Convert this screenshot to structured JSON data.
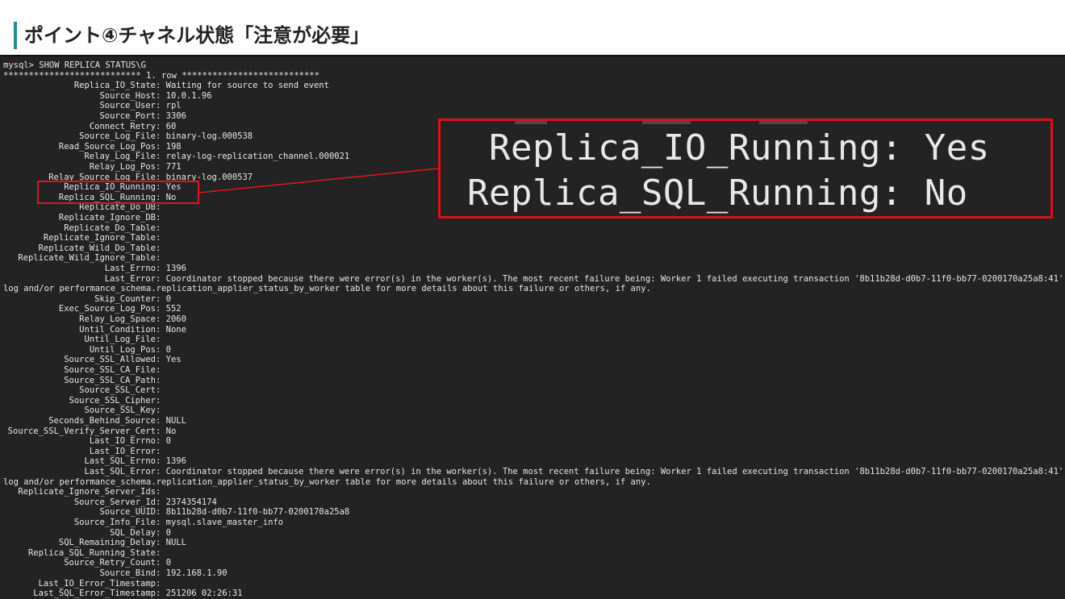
{
  "slide": {
    "title": "ポイント④チャネル状態「注意が必要」",
    "accent_color": "#1f8f94",
    "highlight_color": "#e0161e"
  },
  "terminal": {
    "command": "mysql> SHOW REPLICA STATUS\\G",
    "row_header": "*************************** 1. row ***************************",
    "rows": [
      {
        "k": "Replica_IO_State",
        "v": "Waiting for source to send event"
      },
      {
        "k": "Source_Host",
        "v": "10.0.1.96"
      },
      {
        "k": "Source_User",
        "v": "rpl"
      },
      {
        "k": "Source_Port",
        "v": "3306"
      },
      {
        "k": "Connect_Retry",
        "v": "60"
      },
      {
        "k": "Source_Log_File",
        "v": "binary-log.000538"
      },
      {
        "k": "Read_Source_Log_Pos",
        "v": "198"
      },
      {
        "k": "Relay_Log_File",
        "v": "relay-log-replication_channel.000021"
      },
      {
        "k": "Relay_Log_Pos",
        "v": "771"
      },
      {
        "k": "Relay_Source_Log_File",
        "v": "binary-log.000537"
      },
      {
        "k": "Replica_IO_Running",
        "v": "Yes"
      },
      {
        "k": "Replica_SQL_Running",
        "v": "No"
      },
      {
        "k": "Replicate_Do_DB",
        "v": ""
      },
      {
        "k": "Replicate_Ignore_DB",
        "v": ""
      },
      {
        "k": "Replicate_Do_Table",
        "v": ""
      },
      {
        "k": "Replicate_Ignore_Table",
        "v": ""
      },
      {
        "k": "Replicate_Wild_Do_Table",
        "v": ""
      },
      {
        "k": "Replicate_Wild_Ignore_Table",
        "v": ""
      },
      {
        "k": "Last_Errno",
        "v": "1396"
      },
      {
        "k": "Last_Error",
        "v": "Coordinator stopped because there were error(s) in the worker(s). The most recent failure being: Worker 1 failed executing transaction '8b11b28d-d0b7-11f0-bb77-0200170a25a8:41'"
      },
      {
        "wrap": "log and/or performance_schema.replication_applier_status_by_worker table for more details about this failure or others, if any."
      },
      {
        "k": "Skip_Counter",
        "v": "0"
      },
      {
        "k": "Exec_Source_Log_Pos",
        "v": "552"
      },
      {
        "k": "Relay_Log_Space",
        "v": "2060"
      },
      {
        "k": "Until_Condition",
        "v": "None"
      },
      {
        "k": "Until_Log_File",
        "v": ""
      },
      {
        "k": "Until_Log_Pos",
        "v": "0"
      },
      {
        "k": "Source_SSL_Allowed",
        "v": "Yes"
      },
      {
        "k": "Source_SSL_CA_File",
        "v": ""
      },
      {
        "k": "Source_SSL_CA_Path",
        "v": ""
      },
      {
        "k": "Source_SSL_Cert",
        "v": ""
      },
      {
        "k": "Source_SSL_Cipher",
        "v": ""
      },
      {
        "k": "Source_SSL_Key",
        "v": ""
      },
      {
        "k": "Seconds_Behind_Source",
        "v": "NULL"
      },
      {
        "k": "Source_SSL_Verify_Server_Cert",
        "v": "No"
      },
      {
        "k": "Last_IO_Errno",
        "v": "0"
      },
      {
        "k": "Last_IO_Error",
        "v": ""
      },
      {
        "k": "Last_SQL_Errno",
        "v": "1396"
      },
      {
        "k": "Last_SQL_Error",
        "v": "Coordinator stopped because there were error(s) in the worker(s). The most recent failure being: Worker 1 failed executing transaction '8b11b28d-d0b7-11f0-bb77-0200170a25a8:41'"
      },
      {
        "wrap": "log and/or performance_schema.replication_applier_status_by_worker table for more details about this failure or others, if any."
      },
      {
        "k": "Replicate_Ignore_Server_Ids",
        "v": ""
      },
      {
        "k": "Source_Server_Id",
        "v": "2374354174"
      },
      {
        "k": "Source_UUID",
        "v": "8b11b28d-d0b7-11f0-bb77-0200170a25a8"
      },
      {
        "k": "Source_Info_File",
        "v": "mysql.slave_master_info"
      },
      {
        "k": "SQL_Delay",
        "v": "0"
      },
      {
        "k": "SQL_Remaining_Delay",
        "v": "NULL"
      },
      {
        "k": "Replica_SQL_Running_State",
        "v": ""
      },
      {
        "k": "Source_Retry_Count",
        "v": "0"
      },
      {
        "k": "Source_Bind",
        "v": "192.168.1.90"
      },
      {
        "k": "Last_IO_Error_Timestamp",
        "v": ""
      },
      {
        "k": "Last_SQL_Error_Timestamp",
        "v": "251206 02:26:31"
      }
    ]
  },
  "callout": {
    "line1": "Replica_IO_Running: Yes",
    "line2": "Replica_SQL_Running: No"
  }
}
